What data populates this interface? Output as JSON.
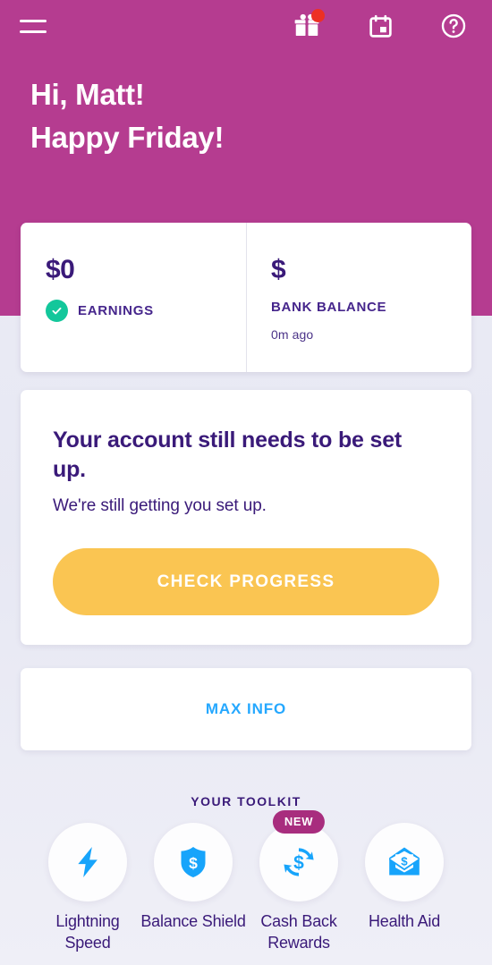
{
  "theme": {
    "header_bg": "#B53C90",
    "page_bg": "#EAEAF4",
    "card_bg": "#FFFFFF",
    "text_purple": "#3A1A79",
    "accent_blue": "#25A8FF",
    "accent_yellow": "#FAC552",
    "accent_green": "#13C79B",
    "badge_red": "#ED3024",
    "badge_magenta": "#A82D7E"
  },
  "header": {
    "menu_icon": "hamburger-menu-icon",
    "actions": [
      {
        "name": "gift-icon",
        "label": "Gift",
        "has_notification": true
      },
      {
        "name": "calendar-icon",
        "label": "Calendar",
        "has_notification": false
      },
      {
        "name": "help-circle-icon",
        "label": "Help",
        "has_notification": false
      }
    ],
    "greeting_line_1": "Hi, Matt!",
    "greeting_line_2": "Happy Friday!"
  },
  "stats": [
    {
      "value": "$0",
      "label": "EARNINGS",
      "has_check": true,
      "sub": ""
    },
    {
      "value": "$",
      "label": "BANK BALANCE",
      "has_check": false,
      "sub": "0m ago"
    }
  ],
  "setup_card": {
    "title": "Your account still needs to be set up.",
    "subtitle": "We're still getting you set up.",
    "cta_label": "CHECK PROGRESS"
  },
  "info_card": {
    "link_label": "MAX INFO"
  },
  "toolkit": {
    "title": "YOUR TOOLKIT",
    "items": [
      {
        "icon": "lightning-bolt-icon",
        "label": "Lightning Speed",
        "badge": ""
      },
      {
        "icon": "shield-dollar-icon",
        "label": "Balance Shield",
        "badge": ""
      },
      {
        "icon": "cash-back-refresh-icon",
        "label": "Cash Back Rewards",
        "badge": "NEW"
      },
      {
        "icon": "envelope-dollar-icon",
        "label": "Health Aid",
        "badge": ""
      }
    ]
  }
}
